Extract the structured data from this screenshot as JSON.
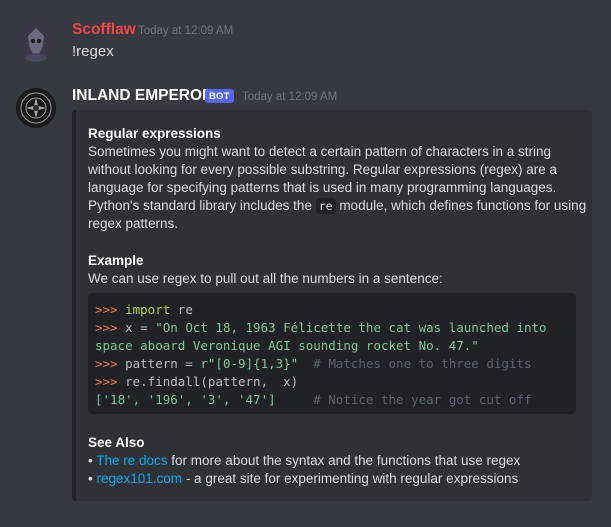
{
  "messages": [
    {
      "username": "Scofflaw",
      "username_color": "#f04747",
      "timestamp": "Today at 12:09 AM",
      "text": "!regex"
    },
    {
      "username": "INLAND EMPEROR",
      "username_color": "#ffffff",
      "bot_tag": "BOT",
      "timestamp": "Today at 12:09 AM"
    }
  ],
  "embed": {
    "section1": {
      "title": "Regular expressions",
      "lines": [
        "Sometimes you might want to detect a certain pattern of characters in a string",
        "without looking for every possible substring. Regular expressions (regex) are a",
        "language for specifying patterns that is used in many programming languages."
      ],
      "line4_pre": "Python's standard library includes the ",
      "line4_code": "re",
      "line4_post": " module, which defines functions for using",
      "line5": "regex patterns."
    },
    "section2": {
      "title": "Example",
      "intro": "We can use regex to pull out all the numbers in a sentence:",
      "code": {
        "prompt": ">>>",
        "l1_kw": "import",
        "l1_rest": " re",
        "l2_pre": " x = ",
        "l2_str": "\"On Oct 18, 1963 Félicette the cat was launched into",
        "l3_str": "space aboard Veronique AGI sounding rocket No. 47.\"",
        "l4_pre": " pattern = ",
        "l4_str": "r\"[0-9]{1,3}\"",
        "l4_com": "  # Matches one to three digits",
        "l5_rest": " re.findall(pattern,  x)",
        "l6_out": "['18', '196', '3', '47']",
        "l6_com": "     # Notice the year got cut off"
      }
    },
    "section3": {
      "title": "See Also",
      "bullet": "•",
      "item1_link": "The re docs",
      "item1_rest": " for more about the syntax and the functions that use regex",
      "item2_link": "regex101.com",
      "item2_rest": " - a great site for experimenting with regular expressions"
    }
  },
  "colors": {
    "background": "#36393f",
    "embed_background": "#2f3136",
    "code_background": "#202225",
    "link": "#00aff4",
    "bot_tag": "#5865f2"
  }
}
